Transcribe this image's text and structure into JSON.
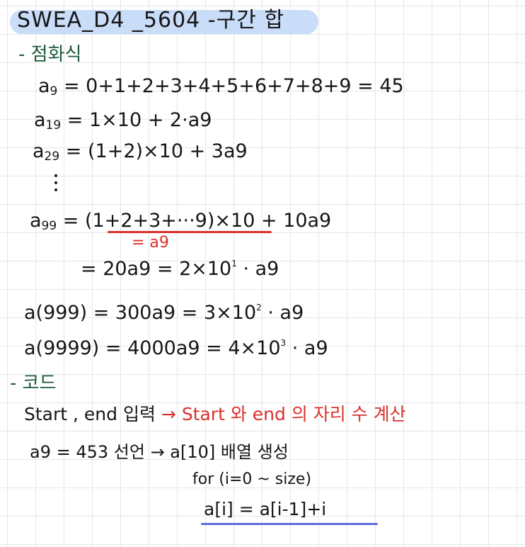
{
  "title": "SWEA_D4 _5604 -구간 합",
  "sections": {
    "recurrence": "- 점화식",
    "code": "- 코드"
  },
  "equations": {
    "a9": {
      "var": "a",
      "sub": "9",
      "rhs": "= 0+1+2+3+4+5+6+7+8+9 = 45"
    },
    "a19": {
      "var": "a",
      "sub": "19",
      "rhs": "= 1×10 + 2·a9"
    },
    "a29": {
      "var": "a",
      "sub": "29",
      "rhs": "= (1+2)×10 + 3a9"
    },
    "a99": {
      "var": "a",
      "sub": "99",
      "rhs_a": "= (1+2+3+···9)",
      "rhs_b": "×10 + 10a9"
    },
    "a99_note": "= a9",
    "a99_line2": "= 20a9  = 2×10",
    "a99_line2_exp": "1",
    "a99_line2_tail": "· a9",
    "a999": {
      "lhs": "a(999) = 300a9  = 3×10",
      "exp": "2",
      "tail": "· a9"
    },
    "a9999": {
      "lhs": "a(9999) = 4000a9 = 4×10",
      "exp": "3",
      "tail": "· a9"
    }
  },
  "code_notes": {
    "line1_black": "Start , end 입력",
    "line1_red": "→ Start 와 end 의 자리 수 계산",
    "line2": "a9 = 453 선언   → a[10] 배열 생성",
    "line3": "for (i=0 ~ size)",
    "line4": "a[i] = a[i-1]+i"
  },
  "colors": {
    "title_highlight": "#c9dcf8",
    "section_heading": "#1c5a3c",
    "red_ink": "#d8312c",
    "blue_underline": "#5d6ee0",
    "grid": "#e6e6e6"
  }
}
